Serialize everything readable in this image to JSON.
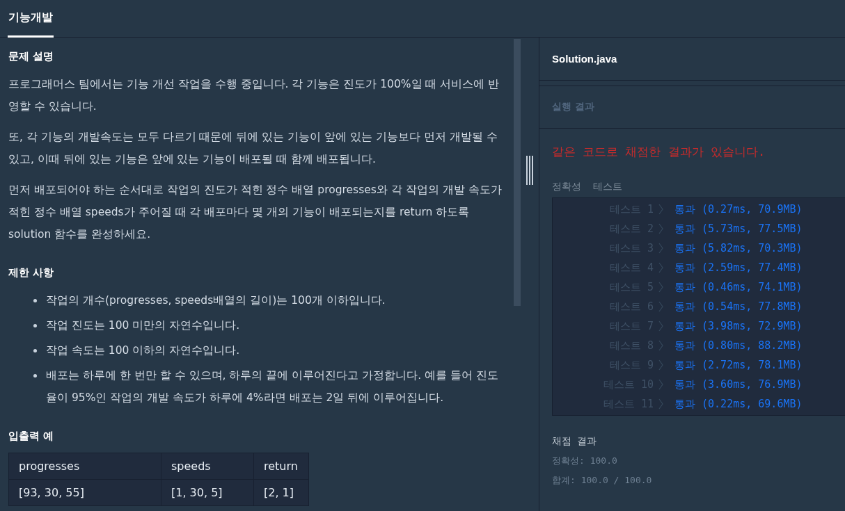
{
  "header": {
    "tabs": [
      {
        "label": "기능개발",
        "selected": true
      }
    ]
  },
  "problem": {
    "title": "문제 설명",
    "paragraphs": [
      "프로그래머스 팀에서는 기능 개선 작업을 수행 중입니다. 각 기능은 진도가 100%일 때 서비스에 반영할 수 있습니다.",
      "또, 각 기능의 개발속도는 모두 다르기 때문에 뒤에 있는 기능이 앞에 있는 기능보다 먼저 개발될 수 있고, 이때 뒤에 있는 기능은 앞에 있는 기능이 배포될 때 함께 배포됩니다.",
      "먼저 배포되어야 하는 순서대로 작업의 진도가 적힌 정수 배열 progresses와 각 작업의 개발 속도가 적힌 정수 배열 speeds가 주어질 때 각 배포마다 몇 개의 기능이 배포되는지를 return 하도록 solution 함수를 완성하세요."
    ]
  },
  "constraints": {
    "title": "제한 사항",
    "items": [
      "작업의 개수(progresses, speeds배열의 길이)는 100개 이하입니다.",
      "작업 진도는 100 미만의 자연수입니다.",
      "작업 속도는 100 이하의 자연수입니다.",
      "배포는 하루에 한 번만 할 수 있으며, 하루의 끝에 이루어진다고 가정합니다. 예를 들어 진도율이 95%인 작업의 개발 속도가 하루에 4%라면 배포는 2일 뒤에 이루어집니다."
    ]
  },
  "examples": {
    "title": "입출력 예",
    "table": {
      "columns": [
        "progresses",
        "speeds",
        "return"
      ],
      "rows": [
        [
          "[93, 30, 55]",
          "[1, 30, 5]",
          "[2, 1]"
        ]
      ]
    }
  },
  "editor": {
    "filename": "Solution.java"
  },
  "results": {
    "title": "실행 결과",
    "message": "같은 코드로 채점한 결과가 있습니다.",
    "group_title": "정확성  테스트",
    "tests": [
      {
        "label": "테스트 1",
        "kind": "pass",
        "result": "통과 (0.27ms, 70.9MB)"
      },
      {
        "label": "테스트 2",
        "kind": "pass",
        "result": "통과 (5.73ms, 77.5MB)"
      },
      {
        "label": "테스트 3",
        "kind": "pass",
        "result": "통과 (5.82ms, 70.3MB)"
      },
      {
        "label": "테스트 4",
        "kind": "pass",
        "result": "통과 (2.59ms, 77.4MB)"
      },
      {
        "label": "테스트 5",
        "kind": "pass",
        "result": "통과 (0.46ms, 74.1MB)"
      },
      {
        "label": "테스트 6",
        "kind": "pass",
        "result": "통과 (0.54ms, 77.8MB)"
      },
      {
        "label": "테스트 7",
        "kind": "pass",
        "result": "통과 (3.98ms, 72.9MB)"
      },
      {
        "label": "테스트 8",
        "kind": "pass",
        "result": "통과 (0.80ms, 88.2MB)"
      },
      {
        "label": "테스트 9",
        "kind": "pass",
        "result": "통과 (2.72ms, 78.1MB)"
      },
      {
        "label": "테스트 10",
        "kind": "pass",
        "result": "통과 (3.60ms, 76.9MB)"
      },
      {
        "label": "테스트 11",
        "kind": "pass",
        "result": "통과 (0.22ms, 69.6MB)"
      }
    ],
    "score_title": "채점 결과",
    "score_lines": [
      "정확성: 100.0",
      "합계: 100.0 / 100.0"
    ]
  }
}
